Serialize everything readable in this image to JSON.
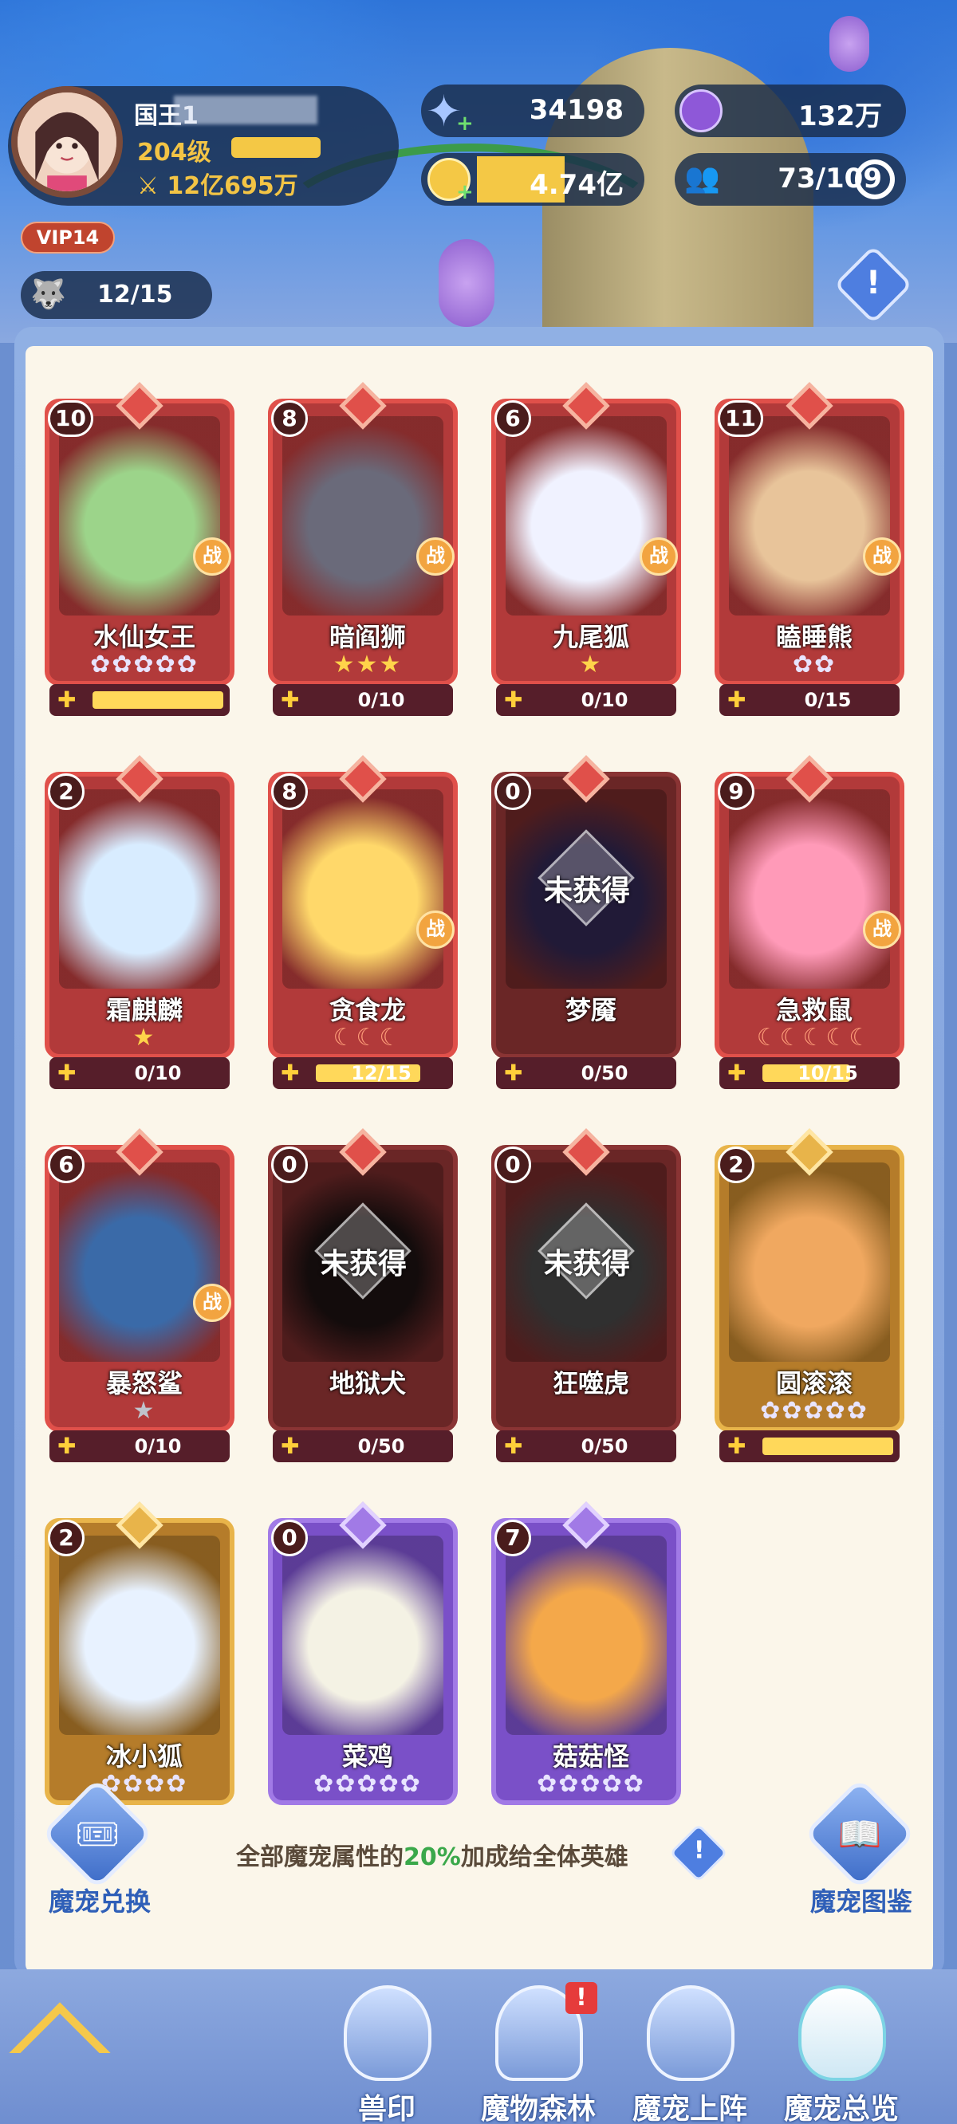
{
  "header": {
    "player_name": "国王1",
    "level": "204级",
    "power": "12亿695万",
    "vip": "VIP14",
    "pet_slots": "12/15",
    "diamonds": "34198",
    "purple_currency": "132万",
    "gold": "4.74亿",
    "party": "73/109",
    "alert_icon": "exclamation-icon"
  },
  "pets": [
    {
      "level": "10",
      "name": "水仙女王",
      "stars": "✿✿✿✿✿",
      "star_style": "white",
      "battle": "战",
      "progress": null,
      "progress_fraction": 1.0,
      "frame": "red",
      "owned": true
    },
    {
      "level": "8",
      "name": "暗阎狮",
      "stars": "★★★",
      "star_style": "gold",
      "battle": "战",
      "progress": "0/10",
      "progress_fraction": 0,
      "frame": "red",
      "owned": true
    },
    {
      "level": "6",
      "name": "九尾狐",
      "stars": "★",
      "star_style": "gold",
      "battle": "战",
      "progress": "0/10",
      "progress_fraction": 0,
      "frame": "red",
      "owned": true
    },
    {
      "level": "11",
      "name": "瞌睡熊",
      "stars": "✿✿",
      "star_style": "white",
      "battle": "战",
      "progress": "0/15",
      "progress_fraction": 0,
      "frame": "red",
      "owned": true
    },
    {
      "level": "2",
      "name": "霜麒麟",
      "stars": "★",
      "star_style": "gold",
      "battle": null,
      "progress": "0/10",
      "progress_fraction": 0,
      "frame": "red",
      "owned": true
    },
    {
      "level": "8",
      "name": "贪食龙",
      "stars": "☾☾☾",
      "star_style": "moon",
      "battle": "战",
      "progress": "12/15",
      "progress_fraction": 0.8,
      "frame": "red",
      "owned": true
    },
    {
      "level": "0",
      "name": "梦魇",
      "stars": "",
      "star_style": "gold",
      "battle": null,
      "progress": "0/50",
      "progress_fraction": 0,
      "frame": "red",
      "owned": false,
      "locked_text": "未获得"
    },
    {
      "level": "9",
      "name": "急救鼠",
      "stars": "☾☾☾☾☾",
      "star_style": "moon",
      "battle": "战",
      "progress": "10/15",
      "progress_fraction": 0.67,
      "frame": "red",
      "owned": true
    },
    {
      "level": "6",
      "name": "暴怒鲨",
      "stars": "★",
      "star_style": "silver",
      "battle": "战",
      "progress": "0/10",
      "progress_fraction": 0,
      "frame": "red",
      "owned": true
    },
    {
      "level": "0",
      "name": "地狱犬",
      "stars": "",
      "star_style": "gold",
      "battle": null,
      "progress": "0/50",
      "progress_fraction": 0,
      "frame": "red",
      "owned": false,
      "locked_text": "未获得"
    },
    {
      "level": "0",
      "name": "狂噬虎",
      "stars": "",
      "star_style": "gold",
      "battle": null,
      "progress": "0/50",
      "progress_fraction": 0,
      "frame": "red",
      "owned": false,
      "locked_text": "未获得"
    },
    {
      "level": "2",
      "name": "圆滚滚",
      "stars": "✿✿✿✿✿",
      "star_style": "white",
      "battle": null,
      "progress": null,
      "progress_fraction": 1.0,
      "frame": "gold",
      "owned": true
    },
    {
      "level": "2",
      "name": "冰小狐",
      "stars": "✿✿✿✿",
      "star_style": "white",
      "battle": null,
      "progress": null,
      "progress_fraction": null,
      "frame": "gold",
      "owned": true
    },
    {
      "level": "0",
      "name": "菜鸡",
      "stars": "✿✿✿✿✿",
      "star_style": "white",
      "battle": null,
      "progress": null,
      "progress_fraction": null,
      "frame": "purple",
      "owned": true
    },
    {
      "level": "7",
      "name": "菇菇怪",
      "stars": "✿✿✿✿✿",
      "star_style": "white",
      "battle": null,
      "progress": null,
      "progress_fraction": null,
      "frame": "purple",
      "owned": true
    }
  ],
  "footer": {
    "exchange_label": "魔宠兑换",
    "codex_label": "魔宠图鉴",
    "bonus_prefix": "全部魔宠属性的",
    "bonus_value": "20%",
    "bonus_suffix": "加成给全体英雄"
  },
  "nav": {
    "tabs": [
      {
        "label": "兽印"
      },
      {
        "label": "魔物森林",
        "badge": "!"
      },
      {
        "label": "魔宠上阵"
      },
      {
        "label": "魔宠总览"
      }
    ]
  },
  "colors": {
    "accent_green": "#3aa84a",
    "card_red": "#e0504a",
    "card_gold": "#e8b44a",
    "card_purple": "#a17ae6",
    "star_gold": "#ffd34a"
  }
}
